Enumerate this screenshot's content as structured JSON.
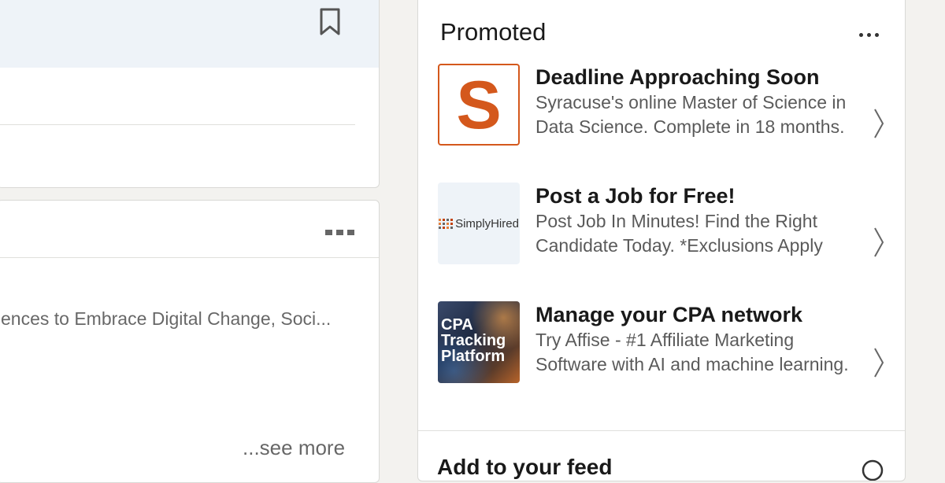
{
  "feed": {
    "post": {
      "snippet": "ences to Embrace Digital Change, Soci...",
      "see_more_label": "...see more"
    }
  },
  "promoted": {
    "title": "Promoted",
    "ads": [
      {
        "heading": "Deadline Approaching Soon",
        "body": "Syracuse's online Master of Science in Data Science. Complete in 18 months.",
        "logo_text": "S",
        "logo_color": "#d4581c"
      },
      {
        "heading": "Post a Job for Free!",
        "body": "Post Job In Minutes! Find the Right Candidate Today. *Exclusions Apply",
        "logo_text": "SimplyHired"
      },
      {
        "heading": "Manage your CPA network",
        "body": "Try Affise - #1 Affiliate Marketing Software with AI and machine learning.",
        "logo_text": "CPA\nTracking\nPlatform"
      }
    ]
  },
  "add_to_feed": {
    "title": "Add to your feed"
  },
  "colors": {
    "page_bg": "#f3f2ef",
    "card_bg": "#ffffff",
    "syracuse_orange": "#d4581c"
  }
}
